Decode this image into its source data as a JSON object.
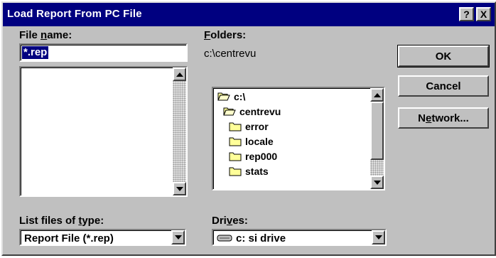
{
  "dialog": {
    "title": "Load Report From PC File",
    "help_label": "?",
    "close_label": "X"
  },
  "file_name": {
    "label_pre": "File ",
    "label_accel": "n",
    "label_post": "ame:",
    "value": "*.rep",
    "file_list": []
  },
  "folders": {
    "label_accel": "F",
    "label_post": "olders:",
    "current_path": "c:\\centrevu",
    "items": [
      {
        "name": "c:\\",
        "state": "open"
      },
      {
        "name": "centrevu",
        "state": "open"
      },
      {
        "name": "error",
        "state": "closed"
      },
      {
        "name": "locale",
        "state": "closed"
      },
      {
        "name": "rep000",
        "state": "closed"
      },
      {
        "name": "stats",
        "state": "closed"
      }
    ]
  },
  "file_type": {
    "label_pre": "List files of ",
    "label_accel": "t",
    "label_post": "ype:",
    "selected": "Report File (*.rep)"
  },
  "drives": {
    "label_pre": "Dri",
    "label_accel": "v",
    "label_post": "es:",
    "selected": "c: si drive"
  },
  "buttons": {
    "ok": "OK",
    "cancel": "Cancel",
    "network_pre": "N",
    "network_accel": "e",
    "network_post": "twork..."
  },
  "colors": {
    "title_bar": "#000080",
    "face": "#c0c0c0",
    "folder": "#ffff99"
  }
}
